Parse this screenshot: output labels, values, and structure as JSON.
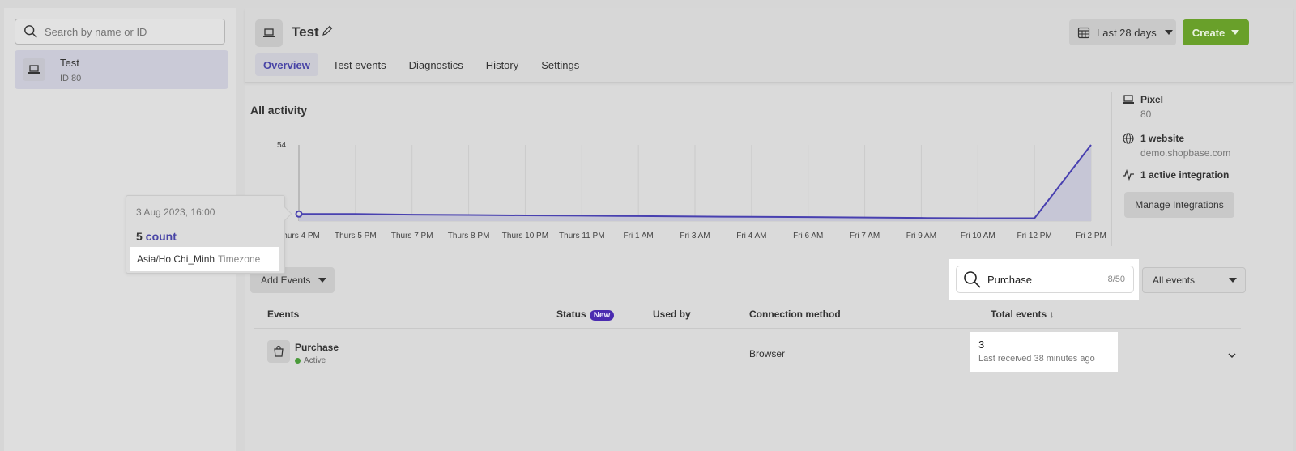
{
  "sidebar": {
    "search_placeholder": "Search by name or ID",
    "items": [
      {
        "name": "Test",
        "id": "ID 80"
      }
    ]
  },
  "header": {
    "title": "Test",
    "date_range": "Last 28 days",
    "create_label": "Create",
    "tabs": [
      {
        "label": "Overview",
        "active": true
      },
      {
        "label": "Test events"
      },
      {
        "label": "Diagnostics"
      },
      {
        "label": "History"
      },
      {
        "label": "Settings"
      }
    ]
  },
  "activity": {
    "title": "All activity"
  },
  "chart_data": {
    "type": "area",
    "title": "",
    "ylim": [
      0,
      54
    ],
    "yticks": [
      "54"
    ],
    "x": [
      "Thurs 4 PM",
      "Thurs 5 PM",
      "Thurs 7 PM",
      "Thurs 8 PM",
      "Thurs 10 PM",
      "Thurs 11 PM",
      "Fri 1 AM",
      "Fri 3 AM",
      "Fri 4 AM",
      "Fri 6 AM",
      "Fri 7 AM",
      "Fri 9 AM",
      "Fri 10 AM",
      "Fri 12 PM",
      "Fri 2 PM"
    ],
    "values": [
      5,
      5,
      4.5,
      4.3,
      4,
      3.8,
      3.5,
      3.2,
      3,
      2.8,
      2.5,
      2.2,
      2,
      2,
      54
    ],
    "color": "#4840b0"
  },
  "info": {
    "pixel_label": "Pixel",
    "pixel_id": "80",
    "website_label": "1 website",
    "website_value": "demo.shopbase.com",
    "integration_label": "1 active integration",
    "manage_label": "Manage Integrations"
  },
  "controls": {
    "add_events_label": "Add Events",
    "search_value": "Purchase",
    "search_count": "8/50",
    "filter_label": "All events"
  },
  "table": {
    "headers": {
      "events": "Events",
      "status": "Status",
      "status_badge": "New",
      "used_by": "Used by",
      "connection": "Connection method",
      "total": "Total events ↓"
    },
    "rows": [
      {
        "name": "Purchase",
        "status": "Active",
        "connection": "Browser",
        "total": "3",
        "last_received": "Last received 38 minutes ago"
      }
    ]
  },
  "tooltip": {
    "date": "3 Aug 2023, 16:00",
    "count": "5",
    "count_unit": "count",
    "timezone": "Asia/Ho Chi_Minh",
    "timezone_label": "Timezone"
  }
}
